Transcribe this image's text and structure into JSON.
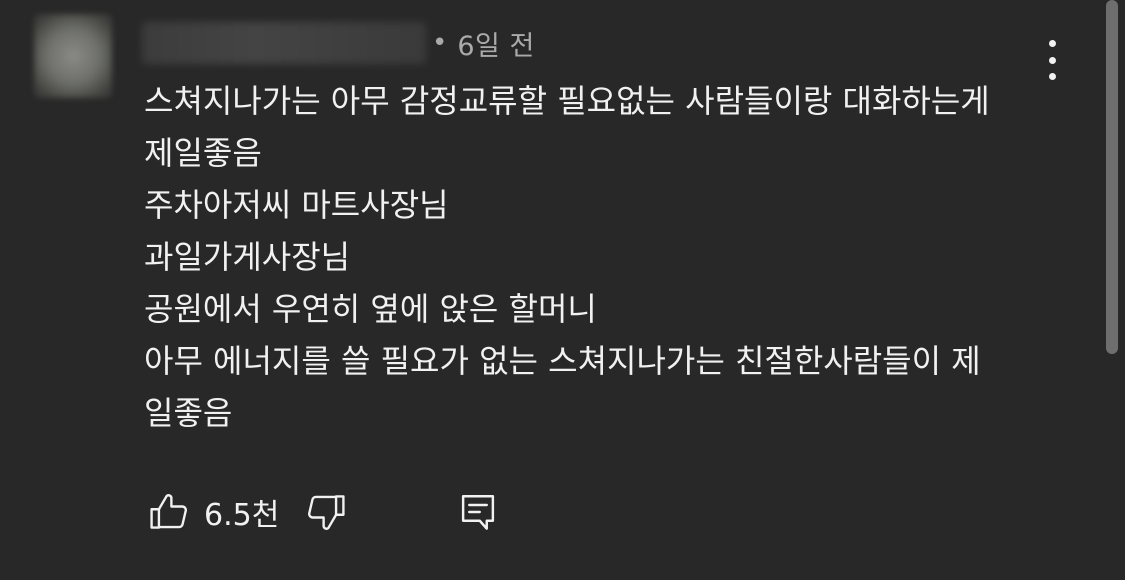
{
  "comment": {
    "avatar_icon": "avatar-blurred",
    "author_name_blurred": true,
    "separator": "•",
    "timestamp": "6일 전",
    "menu_icon": "more-vert-icon",
    "lines": [
      "스쳐지나가는 아무 감정교류할 필요없는 사람들이랑 대화하는게",
      "제일좋음",
      "주차아저씨 마트사장님",
      "과일가게사장님",
      "공원에서 우연히 옆에 앉은 할머니",
      "아무 에너지를 쓸 필요가 없는 스쳐지나가는 친절한사람들이 제",
      "일좋음"
    ],
    "actions": {
      "like_icon": "thumbs-up-icon",
      "like_count": "6.5천",
      "dislike_icon": "thumbs-down-icon",
      "reply_icon": "reply-comment-icon"
    }
  },
  "colors": {
    "background": "#282828",
    "text": "#f1f1f1",
    "secondary_text": "#aaaaaa",
    "scrollbar": "#6e6e6e"
  }
}
